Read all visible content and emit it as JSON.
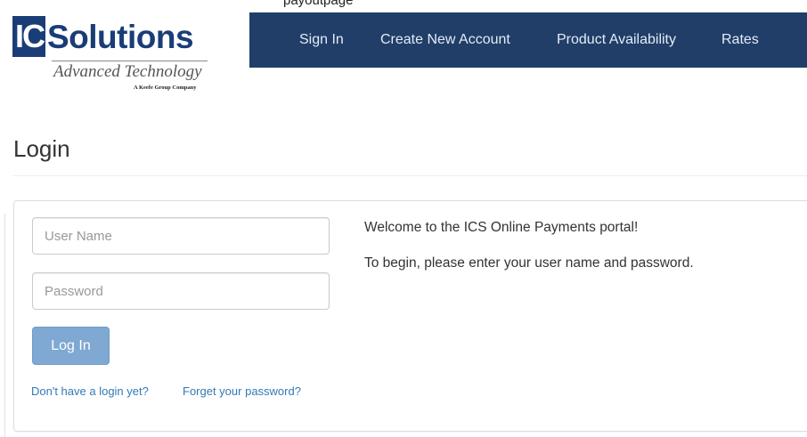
{
  "top_snippet": "payoutpage",
  "logo": {
    "ic": "IC",
    "solutions": "Solutions",
    "tagline": "Advanced Technology",
    "company": "A Keefe Group Company"
  },
  "nav": {
    "items": [
      {
        "label": "Sign In"
      },
      {
        "label": "Create New Account"
      },
      {
        "label": "Product Availability"
      },
      {
        "label": "Rates"
      }
    ]
  },
  "login": {
    "title": "Login",
    "username_placeholder": "User Name",
    "password_placeholder": "Password",
    "button_label": "Log In",
    "no_login_link": "Don't have a login yet?",
    "forgot_link": "Forget your password?"
  },
  "welcome": {
    "line1": "Welcome to the ICS Online Payments portal!",
    "line2": "To begin, please enter your user name and password."
  },
  "colors": {
    "navbar": "#213e68",
    "brand": "#1a3d78",
    "button": "#7fa8d2",
    "link": "#337ab7"
  }
}
